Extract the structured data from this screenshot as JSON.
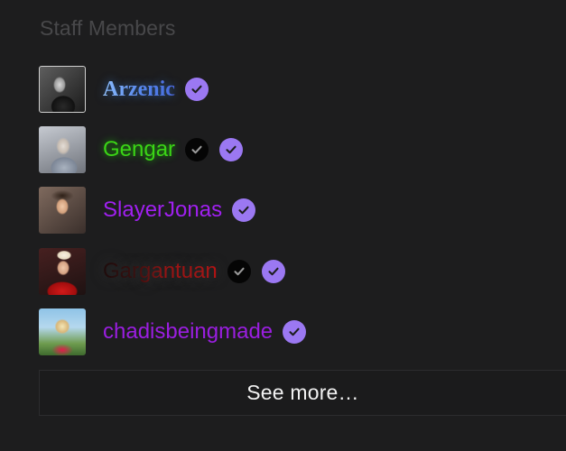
{
  "section": {
    "title": "Staff Members"
  },
  "members": [
    {
      "name": "Arzenic",
      "avatar_icon": "user-avatar-photo",
      "badges": [
        "verified-purple"
      ]
    },
    {
      "name": "Gengar",
      "avatar_icon": "user-avatar-photo",
      "badges": [
        "verified-black",
        "verified-purple"
      ]
    },
    {
      "name": "SlayerJonas",
      "avatar_icon": "user-avatar-photo",
      "badges": [
        "verified-purple"
      ]
    },
    {
      "name": "Gargantuan",
      "avatar_icon": "user-avatar-photo",
      "badges": [
        "verified-black",
        "verified-purple"
      ]
    },
    {
      "name": "chadisbeingmade",
      "avatar_icon": "user-avatar-photo",
      "badges": [
        "verified-purple"
      ]
    }
  ],
  "actions": {
    "see_more_label": "See more…"
  },
  "colors": {
    "background": "#1d1d1e",
    "title": "#48484a",
    "badge_purple": "#9b78f2",
    "badge_black": "#050505",
    "arzenic": "#6fa8e6",
    "gengar": "#3bd516",
    "slayerjonas": "#a020f0",
    "gargantuan": "#b00d0d",
    "chadisbeingmade": "#9a1ee0"
  }
}
